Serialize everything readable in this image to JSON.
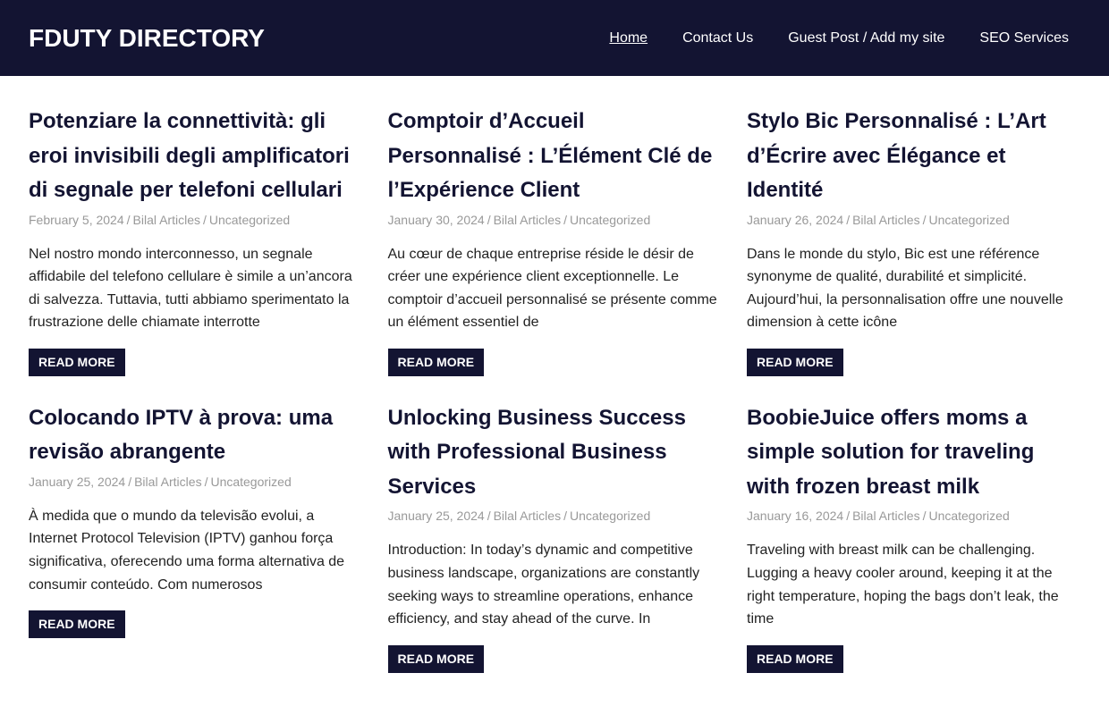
{
  "header": {
    "site_title": "FDUTY DIRECTORY",
    "background_color": "#131432",
    "nav": [
      {
        "label": "Home",
        "current": true
      },
      {
        "label": "Contact Us",
        "current": false
      },
      {
        "label": "Guest Post / Add my site",
        "current": false
      },
      {
        "label": "SEO Services",
        "current": false
      }
    ]
  },
  "posts": [
    {
      "title": "Potenziare la connettività: gli eroi invisibili degli amplificatori di segnale per telefoni cellulari",
      "date": "February 5, 2024",
      "author": "Bilal Articles",
      "category": "Uncategorized",
      "excerpt": "Nel nostro mondo interconnesso, un segnale affidabile del telefono cellulare è simile a un’ancora di salvezza. Tuttavia, tutti abbiamo sperimentato la frustrazione delle chiamate interrotte",
      "read_more": "READ MORE"
    },
    {
      "title": "Comptoir d’Accueil Personnalisé : L’Élément Clé de l’Expérience Client",
      "date": "January 30, 2024",
      "author": "Bilal Articles",
      "category": "Uncategorized",
      "excerpt": "Au cœur de chaque entreprise réside le désir de créer une expérience client exceptionnelle. Le comptoir d’accueil personnalisé se présente comme un élément essentiel de",
      "read_more": "READ MORE"
    },
    {
      "title": "Stylo Bic Personnalisé : L’Art d’Écrire avec Élégance et Identité",
      "date": "January 26, 2024",
      "author": "Bilal Articles",
      "category": "Uncategorized",
      "excerpt": "Dans le monde du stylo, Bic est une référence synonyme de qualité, durabilité et simplicité. Aujourd’hui, la personnalisation offre une nouvelle dimension à cette icône",
      "read_more": "READ MORE"
    },
    {
      "title": "Colocando IPTV à prova: uma revisão abrangente",
      "date": "January 25, 2024",
      "author": "Bilal Articles",
      "category": "Uncategorized",
      "excerpt": "À medida que o mundo da televisão evolui, a Internet Protocol Television (IPTV) ganhou força significativa, oferecendo uma forma alternativa de consumir conteúdo. Com numerosos",
      "read_more": "READ MORE"
    },
    {
      "title": "Unlocking Business Success with Professional Business Services",
      "date": "January 25, 2024",
      "author": "Bilal Articles",
      "category": "Uncategorized",
      "excerpt": "Introduction: In today’s dynamic and competitive business landscape, organizations are constantly seeking ways to streamline operations, enhance efficiency, and stay ahead of the curve. In",
      "read_more": "READ MORE"
    },
    {
      "title": "BoobieJuice offers moms a simple solution for traveling with frozen breast milk",
      "date": "January 16, 2024",
      "author": "Bilal Articles",
      "category": "Uncategorized",
      "excerpt": "Traveling with breast milk can be challenging. Lugging a heavy cooler around, keeping it at the right temperature, hoping the bags don’t leak, the time",
      "read_more": "READ MORE"
    }
  ],
  "meta_separator": "/"
}
